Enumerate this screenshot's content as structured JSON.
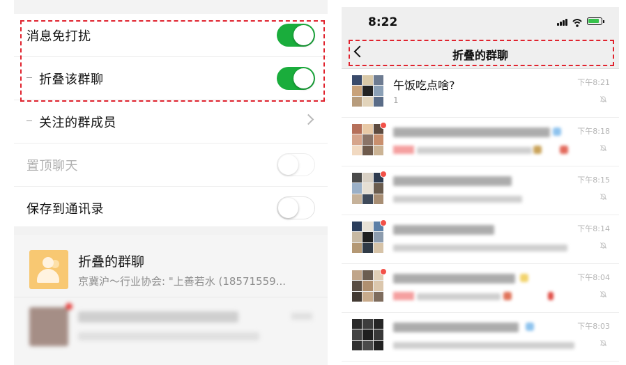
{
  "left": {
    "settings": [
      {
        "label": "消息免打扰",
        "toggle": "on",
        "indent": false
      },
      {
        "label": "折叠该群聊",
        "toggle": "on",
        "indent": true
      },
      {
        "label": "关注的群成员",
        "toggle": null,
        "indent": true,
        "chevron": true
      },
      {
        "label": "置顶聊天",
        "toggle": "off",
        "indent": false,
        "disabled": true
      },
      {
        "label": "保存到通讯录",
        "toggle": "off",
        "indent": false
      }
    ],
    "folded_chat": {
      "title": "折叠的群聊",
      "subtitle": "京冀沪～行业协会: \"上善若水 (18571559..."
    }
  },
  "right": {
    "status_time": "8:22",
    "nav_title": "折叠的群聊",
    "chats": [
      {
        "name": "午饭吃点啥?",
        "preview": "1",
        "time": "下午8:21",
        "blurred": false
      },
      {
        "name": "",
        "preview": "",
        "time": "下午8:18",
        "blurred": true,
        "unread": true
      },
      {
        "name": "",
        "preview": "",
        "time": "下午8:15",
        "blurred": true,
        "unread": true
      },
      {
        "name": "",
        "preview": "",
        "time": "下午8:14",
        "blurred": true,
        "unread": true
      },
      {
        "name": "",
        "preview": "",
        "time": "下午8:04",
        "blurred": true,
        "unread": true
      },
      {
        "name": "",
        "preview": "",
        "time": "下午8:03",
        "blurred": true,
        "unread": false
      }
    ]
  },
  "colors": {
    "toggle_on": "#1aad3c",
    "annotation_red": "#e0232e",
    "unread_dot": "#f25148"
  }
}
